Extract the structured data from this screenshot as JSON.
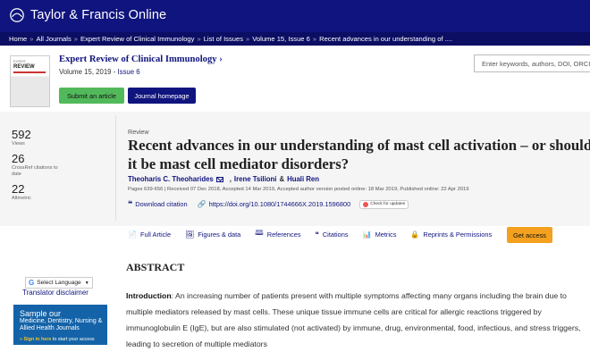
{
  "site": {
    "name": "Taylor & Francis Online"
  },
  "breadcrumb": [
    "Home",
    "All Journals",
    "Expert Review of Clinical Immunology",
    "List of Issues",
    "Volume 15, Issue 6",
    "Recent advances in our understanding of ...."
  ],
  "journal": {
    "title": "Expert Review of Clinical Immunology",
    "chevron": "›",
    "volume_text": "Volume 15, 2019 - ",
    "issue_link": "Issue 6",
    "submit_label": "Submit an article",
    "homepage_label": "Journal homepage",
    "cover_small": "EXPERT",
    "cover_big": "REVIEW"
  },
  "search": {
    "placeholder": "Enter keywords, authors, DOI, ORCID"
  },
  "metrics": [
    {
      "value": "592",
      "label": "Views"
    },
    {
      "value": "26",
      "label": "CrossRef citations to date"
    },
    {
      "value": "22",
      "label": "Altmetric"
    }
  ],
  "article": {
    "type": "Review",
    "title": "Recent advances in our understanding of mast cell activation – or should it be mast cell mediator disorders?",
    "author_1": "Theoharis C. Theoharides",
    "author_2": "Irene Tsilioni",
    "author_sep": "&",
    "author_3": "Huali Ren",
    "pages_line": "Pages 639-656 | Received 07 Dec 2018, Accepted 14 Mar 2019, Accepted author version posted online: 18 Mar 2019, Published online: 22 Apr 2019",
    "download_citation": "Download citation",
    "doi": "https://doi.org/10.1080/1744666X.2019.1596800",
    "check_updates": "Check for updates"
  },
  "tabs": [
    {
      "icon": "📄",
      "label": "Full Article"
    },
    {
      "icon": "🖼",
      "label": "Figures & data"
    },
    {
      "icon": "🕮",
      "label": "References"
    },
    {
      "icon": "❝",
      "label": "Citations"
    },
    {
      "icon": "📊",
      "label": "Metrics"
    },
    {
      "icon": "🔒",
      "label": "Reprints & Permissions"
    }
  ],
  "get_access": "Get access",
  "abstract": {
    "heading": "ABSTRACT",
    "lead": "Introduction",
    "text": ": An increasing number of patients present with multiple symptoms affecting many organs including the brain due to multiple mediators released by mast cells. These unique tissue immune cells are critical for allergic reactions triggered by immunoglobulin E (IgE), but are also stimulated (not activated) by immune, drug, environmental, food, infectious, and stress triggers, leading to secretion of multiple mediators"
  },
  "language": {
    "label": "Select Language",
    "translator": "Translator disclaimer"
  },
  "ad": {
    "line1": "Sample our",
    "line2": "Medicine, Dentistry, Nursing & Allied Health Journals",
    "signin": "» Sign in here",
    "line3": " to start your access"
  },
  "colors": {
    "brand": "#10147e",
    "submit": "#52b95b",
    "access": "#f3a11e"
  }
}
